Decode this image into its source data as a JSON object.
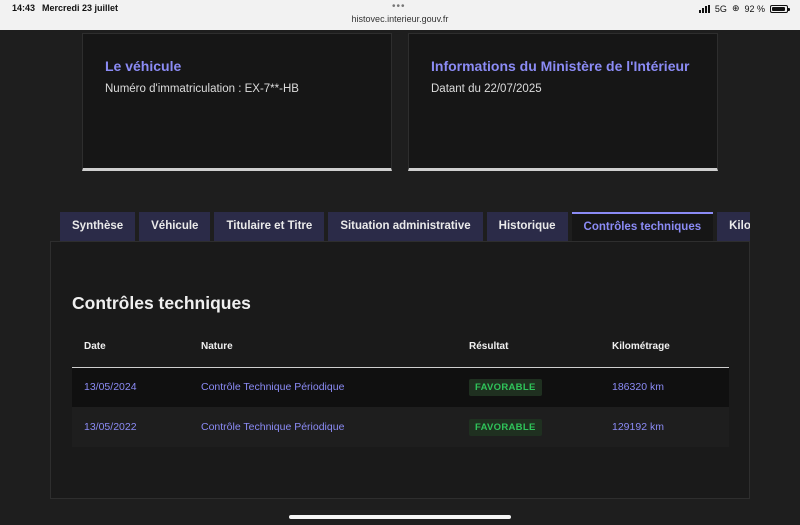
{
  "status_bar": {
    "time": "14:43",
    "date": "Mercredi 23 juillet",
    "url": "histovec.interieur.gouv.fr",
    "network": "5G",
    "battery": "92 %",
    "battery_level": 0.92
  },
  "cards": {
    "vehicle": {
      "title": "Le véhicule",
      "text": "Numéro d'immatriculation : EX-7**-HB"
    },
    "ministry": {
      "title": "Informations du Ministère de l'Intérieur",
      "text": "Datant du 22/07/2025"
    }
  },
  "tabs": [
    "Synthèse",
    "Véhicule",
    "Titulaire et Titre",
    "Situation administrative",
    "Historique",
    "Contrôles techniques",
    "Kilométrage"
  ],
  "active_tab": "Contrôles techniques",
  "section": {
    "title": "Contrôles techniques",
    "columns": [
      "Date",
      "Nature",
      "Résultat",
      "Kilométrage"
    ],
    "rows": [
      [
        "13/05/2024",
        "Contrôle Technique Périodique",
        "FAVORABLE",
        "186320 km"
      ],
      [
        "13/05/2022",
        "Contrôle Technique Périodique",
        "FAVORABLE",
        "129192 km"
      ]
    ]
  },
  "colors": {
    "accent": "#8b8bf5",
    "success": "#2fc45a",
    "background": "#1e1e1e"
  }
}
